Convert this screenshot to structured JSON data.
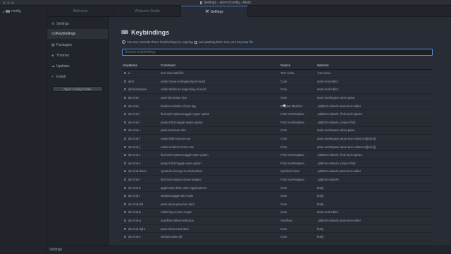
{
  "window": {
    "title": "Settings - atom://config - Atom"
  },
  "tree": {
    "root_label": "config"
  },
  "tabs": [
    {
      "label": "Welcome"
    },
    {
      "label": "Welcome Guide"
    },
    {
      "label": "Settings"
    }
  ],
  "settings_nav": {
    "items": [
      {
        "label": "Settings",
        "icon": "settings-icon"
      },
      {
        "label": "Keybindings",
        "icon": "keyboard-icon"
      },
      {
        "label": "Packages",
        "icon": "package-icon"
      },
      {
        "label": "Themes",
        "icon": "paintcan-icon"
      },
      {
        "label": "Updates",
        "icon": "cloud-download-icon"
      },
      {
        "label": "Install",
        "icon": "plus-icon"
      }
    ],
    "open_config_label": "Open Config Folder"
  },
  "keybindings": {
    "title": "Keybindings",
    "info_before": "You can override these keybindings by copying",
    "info_middle": "and pasting them into your",
    "info_link": "keymap file",
    "search_placeholder": "Search keybindings",
    "columns": [
      "Keystroke",
      "Command",
      "Source",
      "Selector"
    ],
    "rows": [
      [
        "a",
        "tree-view:add-file",
        "Tree View",
        ".tree-view"
      ],
      [
        "alt-b",
        "editor:move-to-beginning-of-word",
        "Core",
        "atom-text-editor"
      ],
      [
        "alt-backspace",
        "editor:delete-to-beginning-of-word",
        "Core",
        "atom-text-editor"
      ],
      [
        "alt-cmd-,",
        "pane:decrease-size",
        "Core",
        "atom-workspace atom-pane"
      ],
      [
        "alt-cmd-.",
        "bracket-matcher:close-tag",
        "Bracket Matcher",
        ".platform-darwin atom-text-editor"
      ],
      [
        "alt-cmd-/",
        "find-and-replace:toggle-regex-option",
        "Find And Replace",
        ".platform-darwin .find-and-replace"
      ],
      [
        "alt-cmd-/",
        "project-find:toggle-regex-option",
        "Find And Replace",
        ".platform-darwin .project-find"
      ],
      [
        "alt-cmd-=",
        "pane:increase-size",
        "Core",
        "atom-workspace atom-pane"
      ],
      [
        "alt-cmd-[",
        "editor:fold-current-row",
        "Core",
        "atom-workspace atom-text-editor:not([mini])"
      ],
      [
        "alt-cmd-]",
        "editor:unfold-current-row",
        "Core",
        "atom-workspace atom-text-editor:not([mini])"
      ],
      [
        "alt-cmd-c",
        "find-and-replace:toggle-case-option",
        "Find And Replace",
        ".platform-darwin .find-and-replace"
      ],
      [
        "alt-cmd-c",
        "project-find:toggle-case-option",
        "Find And Replace",
        ".platform-darwin .project-find"
      ],
      [
        "alt-cmd-down",
        "symbols-view:go-to-declaration",
        "Symbols View",
        ".platform-darwin atom-text-editor"
      ],
      [
        "alt-cmd-f",
        "find-and-replace:show-replace",
        "Find And Replace",
        ".platform-darwin"
      ],
      [
        "alt-cmd-h",
        "application:hide-other-applications",
        "Core",
        "body"
      ],
      [
        "alt-cmd-i",
        "window:toggle-dev-tools",
        "Core",
        "body"
      ],
      [
        "alt-cmd-left",
        "pane:show-previous-item",
        "Core",
        "body"
      ],
      [
        "alt-cmd-p",
        "editor:log-cursor-scope",
        "Core",
        "atom-text-editor"
      ],
      [
        "alt-cmd-q",
        "autoflow:reflow-selection",
        "Autoflow",
        ".platform-darwin atom-text-editor"
      ],
      [
        "alt-cmd-right",
        "pane:show-next-item",
        "Core",
        "body"
      ],
      [
        "alt-cmd-s",
        "window:save-all",
        "Core",
        "body"
      ]
    ]
  },
  "status_bar": {
    "label": "Settings"
  }
}
